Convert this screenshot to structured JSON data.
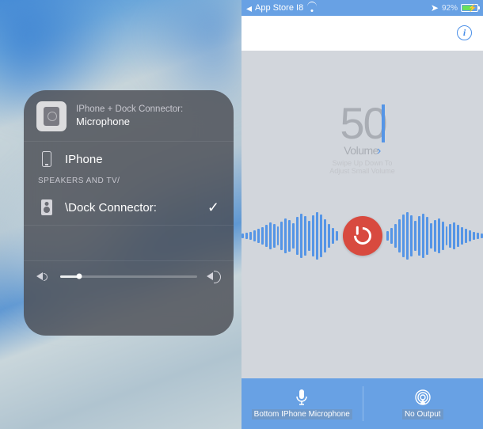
{
  "airplay": {
    "header_title": "IPhone + Dock Connector:",
    "header_sub": "Microphone",
    "row_iphone": "IPhone",
    "section_label": "SPEAKERS AND TV/",
    "row_dock": "\\Dock Connector:",
    "checkmark": "✓"
  },
  "status": {
    "back_label": "App Store I8",
    "battery_pct": "92%"
  },
  "volume": {
    "number": "50",
    "label": "Volume",
    "hint1": "Swipe Up Down To",
    "hint2": "Adjust Small Volume"
  },
  "bottom": {
    "mic_label": "Bottom IPhone Microphone",
    "out_label": "No Output"
  },
  "info_glyph": "i",
  "colors": {
    "accent": "#68a1e4",
    "danger": "#d84a3f"
  }
}
